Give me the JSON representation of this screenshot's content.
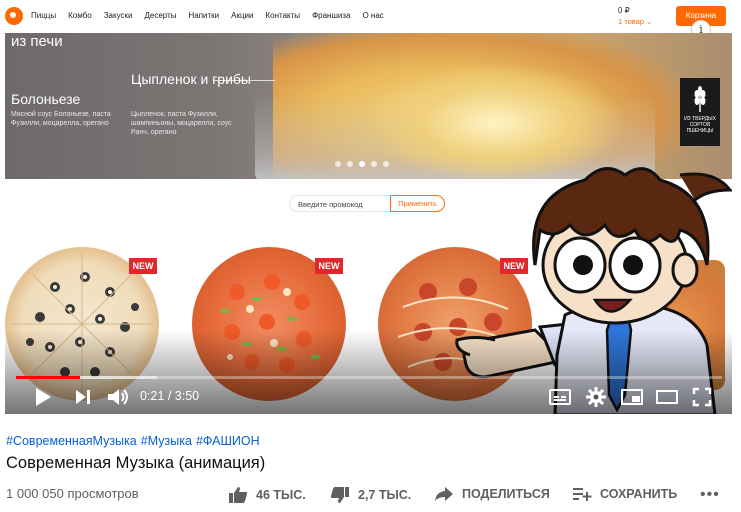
{
  "site": {
    "nav": [
      "Пиццы",
      "Комбо",
      "Закуски",
      "Десерты",
      "Напитки",
      "Акции",
      "Контакты",
      "Франшиза",
      "О нас"
    ],
    "cart_sum": "0 ₽",
    "cart_items": "1 товар ⌄",
    "cart_button": "Корзина",
    "banner": {
      "top_text": "из печи",
      "left_title": "Болоньезе",
      "left_desc": "Мясной соус Болоньезе, паста Фузилли, моцарелла, орегано",
      "mid_title": "Цыпленок и грибы",
      "mid_desc": "Цыпленок, паста Фузилли, шампиньоны, моцарелла, соус Ранч, орегано",
      "badge_text": "ИЗ ТВЕРДЫХ СОРТОВ ПШЕНИЦЫ"
    },
    "promo_placeholder": "Введите промокод",
    "promo_button": "Применить",
    "new_badge": "NEW"
  },
  "player": {
    "current_time": "0:21",
    "duration": "3:50",
    "progress_fraction": 0.091,
    "buffered_fraction": 0.2
  },
  "video": {
    "hashtags": [
      "#СовременнаяМузыка",
      "#Музыка",
      "#ФАШИОН"
    ],
    "title": "Современная Музыка (анимация)",
    "views": "1 000 050 просмотров",
    "likes": "46 ТЫС.",
    "dislikes": "2,7 ТЫС.",
    "share_label": "ПОДЕЛИТЬСЯ",
    "save_label": "СОХРАНИТЬ",
    "more_label": "•••"
  },
  "colors": {
    "brand_orange": "#ff6900",
    "progress_red": "#ff0000",
    "hashtag_blue": "#065fd4"
  }
}
